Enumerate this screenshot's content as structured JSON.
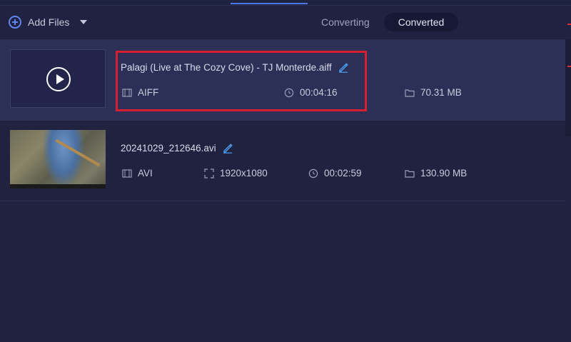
{
  "toolbar": {
    "add_files_label": "Add Files"
  },
  "tabs": [
    {
      "label": "Converting",
      "active": false
    },
    {
      "label": "Converted",
      "active": true
    }
  ],
  "files": [
    {
      "name": "Palagi (Live at The Cozy Cove) - TJ Monterde.aiff",
      "format": "AIFF",
      "duration": "00:04:16",
      "size": "70.31 MB",
      "selected": true,
      "thumbnail": "audio-play-icon"
    },
    {
      "name": "20241029_212646.avi",
      "format": "AVI",
      "resolution": "1920x1080",
      "duration": "00:02:59",
      "size": "130.90 MB",
      "selected": false,
      "thumbnail": "video-frame"
    }
  ],
  "colors": {
    "background": "#20223f",
    "selected_row": "#2c2f56",
    "accent": "#5f86ee",
    "highlight_box": "#d51e2f"
  }
}
